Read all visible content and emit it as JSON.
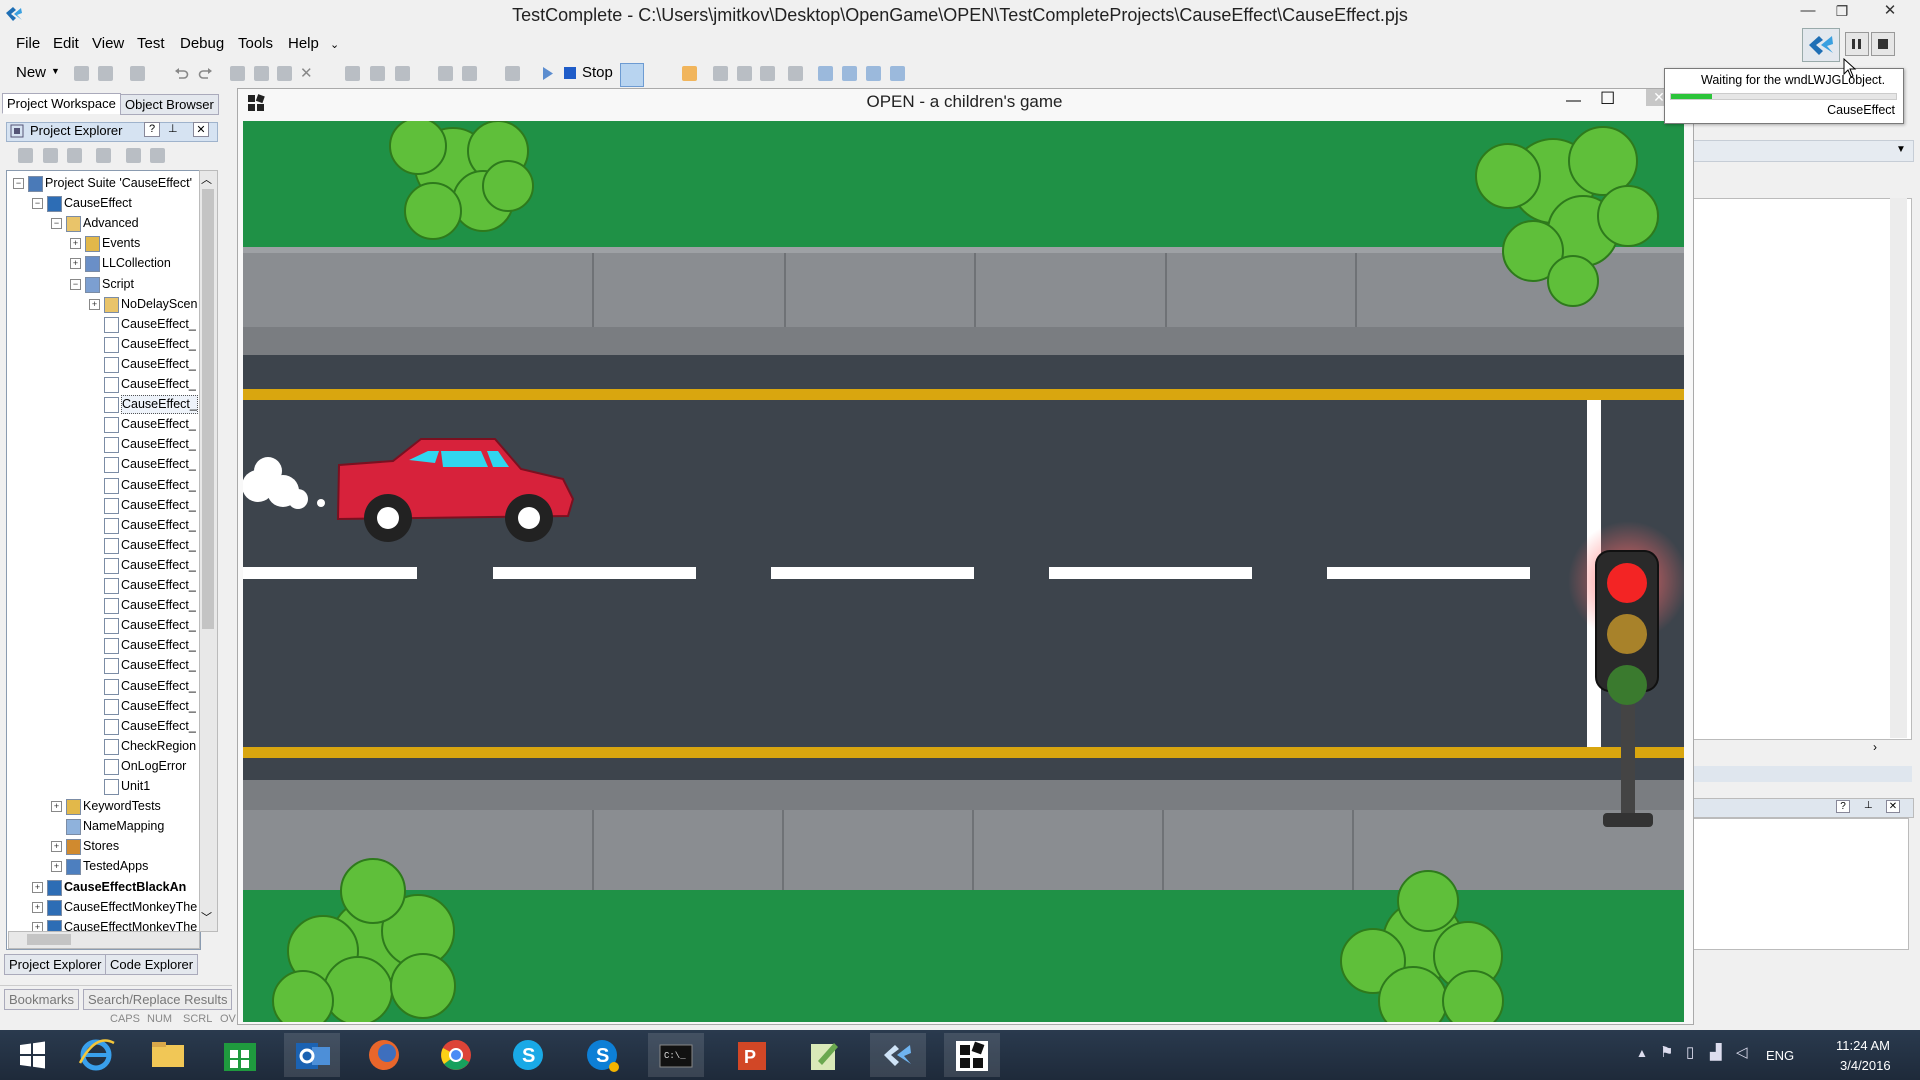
{
  "window": {
    "title": "TestComplete - C:\\Users\\jmitkov\\Desktop\\OpenGame\\OPEN\\TestCompleteProjects\\CauseEffect\\CauseEffect.pjs",
    "minimize": "—",
    "maximize": "❐",
    "close": "✕"
  },
  "menu": [
    "File",
    "Edit",
    "View",
    "Test",
    "Debug",
    "Tools",
    "Help"
  ],
  "toolbar": {
    "new_label": "New",
    "stop_label": "Stop"
  },
  "left_panel": {
    "tabs_top": [
      "Project Workspace",
      "Object Browser"
    ],
    "explorer_title": "Project Explorer",
    "tree": [
      {
        "label": "Project Suite 'CauseEffect'",
        "level": 0,
        "exp": "−",
        "icon": "suite"
      },
      {
        "label": "CauseEffect",
        "level": 1,
        "exp": "−",
        "icon": "project"
      },
      {
        "label": "Advanced",
        "level": 2,
        "exp": "−",
        "icon": "folder-open"
      },
      {
        "label": "Events",
        "level": 3,
        "exp": "+",
        "icon": "events"
      },
      {
        "label": "LLCollection",
        "level": 3,
        "exp": "+",
        "icon": "collection"
      },
      {
        "label": "Script",
        "level": 3,
        "exp": "−",
        "icon": "script"
      },
      {
        "label": "NoDelayScen",
        "level": 4,
        "exp": "+",
        "icon": "folder"
      },
      {
        "label": "CauseEffect_",
        "level": 4,
        "icon": "unit"
      },
      {
        "label": "CauseEffect_",
        "level": 4,
        "icon": "unit"
      },
      {
        "label": "CauseEffect_",
        "level": 4,
        "icon": "unit"
      },
      {
        "label": "CauseEffect_",
        "level": 4,
        "icon": "unit"
      },
      {
        "label": "CauseEffect_",
        "level": 4,
        "icon": "unit",
        "selected": true
      },
      {
        "label": "CauseEffect_",
        "level": 4,
        "icon": "unit"
      },
      {
        "label": "CauseEffect_",
        "level": 4,
        "icon": "unit"
      },
      {
        "label": "CauseEffect_",
        "level": 4,
        "icon": "unit"
      },
      {
        "label": "CauseEffect_",
        "level": 4,
        "icon": "unit"
      },
      {
        "label": "CauseEffect_",
        "level": 4,
        "icon": "unit"
      },
      {
        "label": "CauseEffect_",
        "level": 4,
        "icon": "unit"
      },
      {
        "label": "CauseEffect_",
        "level": 4,
        "icon": "unit"
      },
      {
        "label": "CauseEffect_",
        "level": 4,
        "icon": "unit"
      },
      {
        "label": "CauseEffect_",
        "level": 4,
        "icon": "unit"
      },
      {
        "label": "CauseEffect_",
        "level": 4,
        "icon": "unit"
      },
      {
        "label": "CauseEffect_",
        "level": 4,
        "icon": "unit"
      },
      {
        "label": "CauseEffect_",
        "level": 4,
        "icon": "unit"
      },
      {
        "label": "CauseEffect_",
        "level": 4,
        "icon": "unit"
      },
      {
        "label": "CauseEffect_",
        "level": 4,
        "icon": "unit"
      },
      {
        "label": "CauseEffect_",
        "level": 4,
        "icon": "unit"
      },
      {
        "label": "CauseEffect_",
        "level": 4,
        "icon": "unit"
      },
      {
        "label": "CheckRegion",
        "level": 4,
        "icon": "unit"
      },
      {
        "label": "OnLogError",
        "level": 4,
        "icon": "unit"
      },
      {
        "label": "Unit1",
        "level": 4,
        "icon": "unit"
      },
      {
        "label": "KeywordTests",
        "level": 2,
        "exp": "+",
        "icon": "keyword"
      },
      {
        "label": "NameMapping",
        "level": 2,
        "icon": "mapping"
      },
      {
        "label": "Stores",
        "level": 2,
        "exp": "+",
        "icon": "stores"
      },
      {
        "label": "TestedApps",
        "level": 2,
        "exp": "+",
        "icon": "apps"
      },
      {
        "label": "CauseEffectBlackAn",
        "level": 1,
        "exp": "+",
        "icon": "project",
        "bold": true
      },
      {
        "label": "CauseEffectMonkeyThe",
        "level": 1,
        "exp": "+",
        "icon": "project"
      },
      {
        "label": "CauseEffectMonkeyThe",
        "level": 1,
        "exp": "+",
        "icon": "project"
      }
    ],
    "tabs_bottom": [
      "Project Explorer",
      "Code Explorer"
    ],
    "panel_tabs": [
      "Bookmarks",
      "Search/Replace Results"
    ],
    "status": [
      "CAPS",
      "NUM",
      "SCRL",
      "OV"
    ]
  },
  "game": {
    "title": "OPEN - a children's game",
    "minimize": "—",
    "maximize": "☐",
    "close": "✕",
    "traffic_light_state": "red"
  },
  "tooltip": {
    "message": "Waiting for the wndLWJGLobject.",
    "project": "CauseEffect"
  },
  "taskbar": {
    "apps": [
      "start-icon",
      "ie-icon",
      "file-explorer-icon",
      "store-icon",
      "outlook-icon",
      "firefox-icon",
      "chrome-icon",
      "skype-icon",
      "skype-business-icon",
      "cmd-icon",
      "powerpoint-icon",
      "notepad-icon",
      "testcomplete-icon",
      "game-icon"
    ],
    "lang": "ENG",
    "time": "11:24 AM",
    "date": "3/4/2016"
  },
  "colors": {
    "grass": "#1f9146",
    "curb": "#8a8d91",
    "asphalt": "#3d444c",
    "yellow_line": "#d9a60f",
    "car": "#d7223b",
    "window_cyan": "#31d6ef",
    "light_red": "#f32424"
  }
}
